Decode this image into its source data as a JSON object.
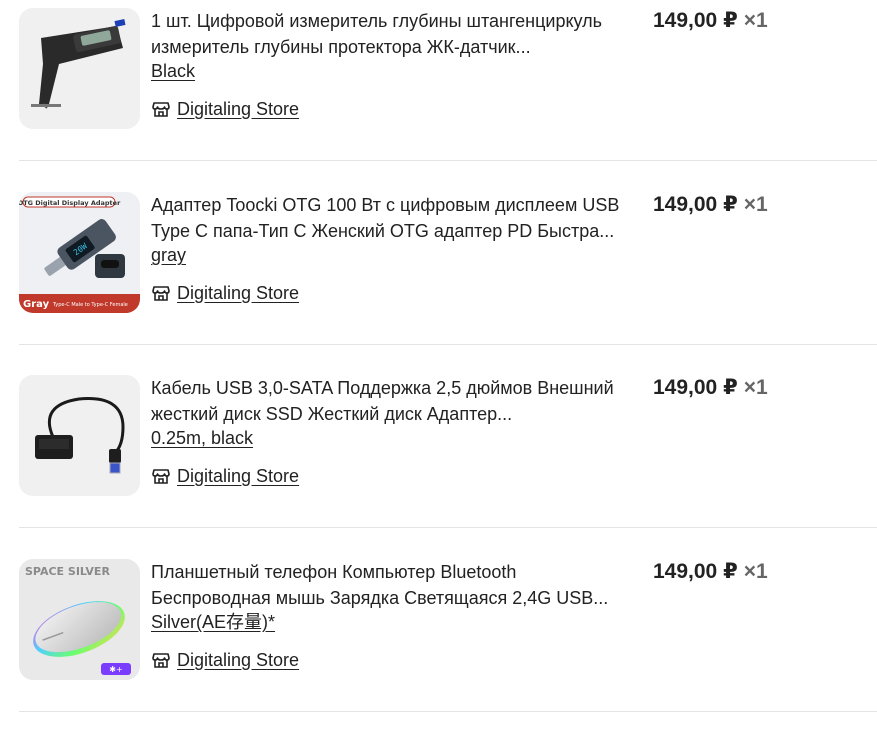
{
  "cart": {
    "items": [
      {
        "title": "1 шт. Цифровой измеритель глубины штангенциркуль измеритель глубины протектора ЖК-датчик...",
        "variant": "Black",
        "store": "Digitaling Store",
        "price": "149,00 ₽",
        "quantity": "×1",
        "image_icon": "digital-depth-gauge-icon"
      },
      {
        "title": "Адаптер Toocki OTG 100 Вт с цифровым дисплеем USB Type C папа-Тип C Женский OTG адаптер PD Быстра...",
        "variant": "gray",
        "store": "Digitaling Store",
        "price": "149,00 ₽",
        "quantity": "×1",
        "image_icon": "otg-adapter-icon",
        "image_caption_top": "OTG Digital Display Adapter",
        "image_caption_bottom": "Gray",
        "image_caption_bottom_small": "Type-C Male to Type-C Female"
      },
      {
        "title": "Кабель USB 3,0-SATA Поддержка 2,5 дюймов Внешний жесткий диск SSD Жесткий диск Адаптер...",
        "variant": "0.25m, black",
        "store": "Digitaling Store",
        "price": "149,00 ₽",
        "quantity": "×1",
        "image_icon": "usb-sata-cable-icon"
      },
      {
        "title": "Планшетный телефон Компьютер Bluetooth Беспроводная мышь Зарядка Светящаяся 2,4G USB...",
        "variant": "Silver(AE存量)*",
        "store": "Digitaling Store",
        "price": "149,00 ₽",
        "quantity": "×1",
        "image_icon": "wireless-mouse-icon",
        "image_caption_top": "SPACE SILVER"
      }
    ]
  },
  "colors": {
    "text": "#222222",
    "muted": "#666666",
    "divider": "#e4e4e4",
    "thumb_bg": "#f2f2f2",
    "otg_badge": "#c0392b"
  }
}
